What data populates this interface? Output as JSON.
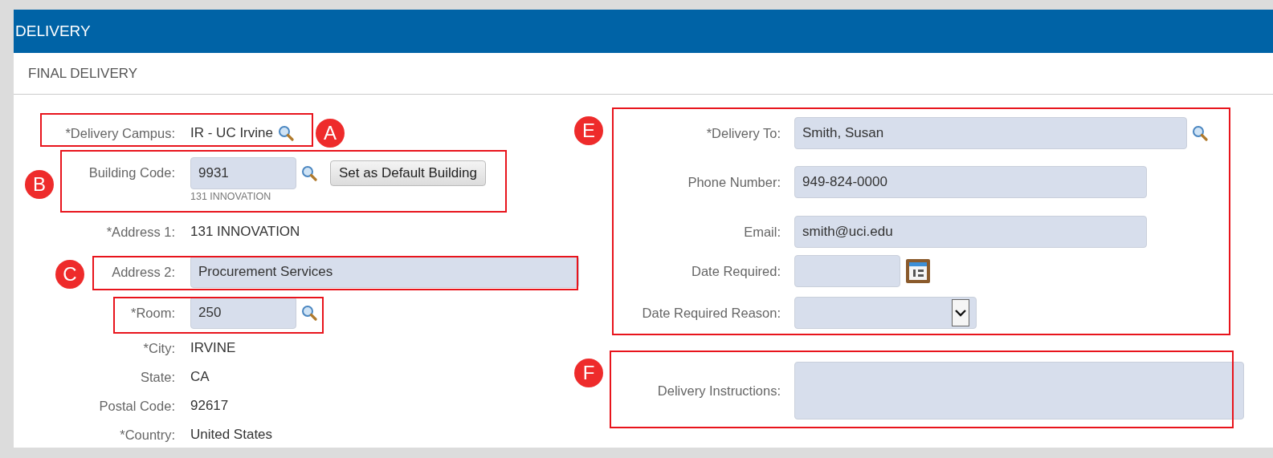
{
  "panel": {
    "title": "DELIVERY",
    "section": "FINAL DELIVERY"
  },
  "left_fields": [
    {
      "label": "*Delivery Campus:",
      "kind": "static",
      "value": "IR - UC Irvine",
      "lookup": true
    },
    {
      "label": "Building Code:",
      "kind": "code",
      "value": "9931",
      "lookup": true,
      "button": "Set as Default Building",
      "note": "131 INNOVATION"
    },
    {
      "label": "*Address 1:",
      "kind": "static",
      "value": "131 INNOVATION",
      "lookup": false
    },
    {
      "label": "Address 2:",
      "kind": "wide",
      "value": "Procurement Services",
      "lookup": false
    },
    {
      "label": "*Room:",
      "kind": "code",
      "value": "250",
      "lookup": true
    },
    {
      "label": "*City:",
      "kind": "static",
      "value": "IRVINE",
      "lookup": false
    },
    {
      "label": "State:",
      "kind": "static",
      "value": "CA",
      "lookup": false
    },
    {
      "label": "Postal Code:",
      "kind": "static",
      "value": "92617",
      "lookup": false
    },
    {
      "label": "*Country:",
      "kind": "static",
      "value": "United States",
      "lookup": false
    }
  ],
  "right_fields": [
    {
      "label": "*Delivery To:",
      "kind": "long",
      "value": "Smith, Susan",
      "lookup": true
    },
    {
      "label": "Phone Number:",
      "kind": "medium",
      "value": "949-824-0000",
      "lookup": false
    },
    {
      "label": "Email:",
      "kind": "medium",
      "value": "smith@uci.edu",
      "lookup": false
    },
    {
      "label": "Date Required:",
      "kind": "date",
      "lookup": false
    },
    {
      "label": "Date Required Reason:",
      "kind": "select",
      "lookup": false
    },
    {
      "label": "Delivery Instructions:",
      "kind": "textarea",
      "lookup": false
    }
  ],
  "callouts": [
    {
      "letter": "A"
    },
    {
      "letter": "B"
    },
    {
      "letter": "C"
    },
    {
      "letter": "E"
    },
    {
      "letter": "F"
    }
  ]
}
